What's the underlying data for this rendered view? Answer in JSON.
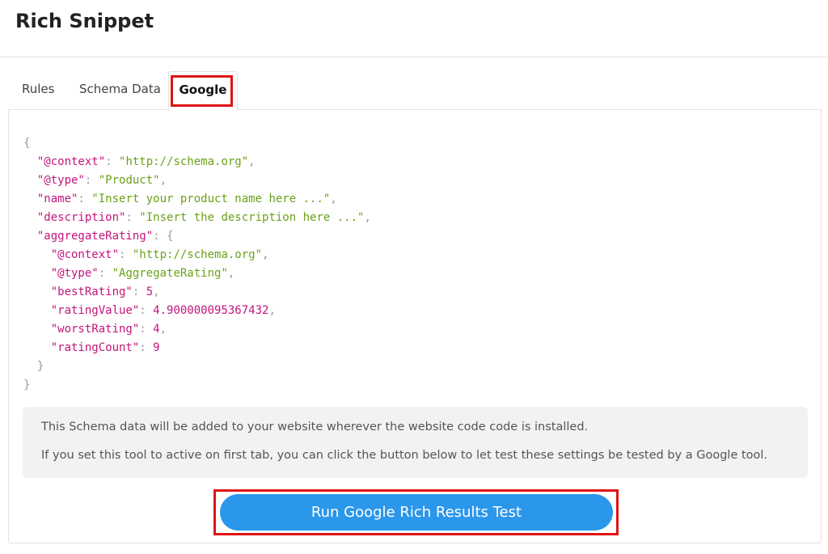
{
  "page": {
    "title": "Rich Snippet"
  },
  "tabs": [
    {
      "label": "Rules"
    },
    {
      "label": "Schema Data"
    },
    {
      "label": "Google",
      "active": true
    }
  ],
  "schema": {
    "open": "{",
    "close": "}",
    "context_key": "\"@context\"",
    "context_val": "\"http://schema.org\"",
    "type_key": "\"@type\"",
    "type_val": "\"Product\"",
    "name_key": "\"name\"",
    "name_val": "\"Insert your product name here ...\"",
    "desc_key": "\"description\"",
    "desc_val": "\"Insert the description here ...\"",
    "agg_key": "\"aggregateRating\"",
    "agg_open": "{",
    "agg_close": "}",
    "agg_context_key": "\"@context\"",
    "agg_context_val": "\"http://schema.org\"",
    "agg_type_key": "\"@type\"",
    "agg_type_val": "\"AggregateRating\"",
    "best_key": "\"bestRating\"",
    "best_val": "5",
    "value_key": "\"ratingValue\"",
    "value_val": "4.900000095367432",
    "worst_key": "\"worstRating\"",
    "worst_val": "4",
    "count_key": "\"ratingCount\"",
    "count_val": "9"
  },
  "info": {
    "line1": "This Schema data will be added to your website wherever the website code code is installed.",
    "line2": "If you set this tool to active on first tab, you can click the button below to let test these settings be tested by a Google tool."
  },
  "actions": {
    "run_label": "Run Google Rich Results Test"
  },
  "colors": {
    "accent": "#2a97ea",
    "highlight": "#e01414",
    "json_key": "#c3147c",
    "json_string": "#6aa118"
  }
}
